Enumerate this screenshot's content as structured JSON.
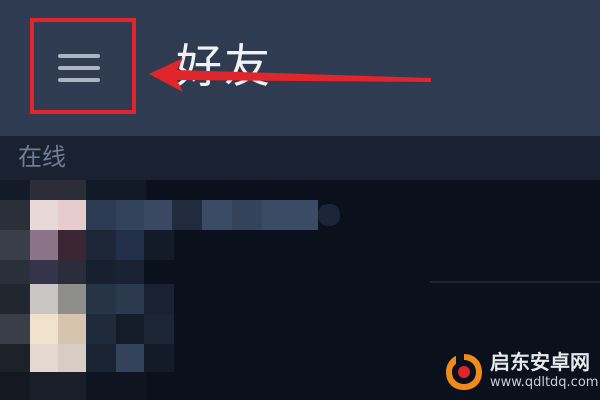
{
  "header": {
    "title": "好友",
    "menu_icon": "hamburger-menu-icon",
    "highlight_color": "#e0262b",
    "background_color": "#2f3b50"
  },
  "section": {
    "label": "在线"
  },
  "annotation": {
    "type": "red-arrow",
    "points_to": "menu-button",
    "color": "#e0262b"
  },
  "watermark": {
    "site_name": "启东安卓网",
    "url": "www.qdltdq.com"
  }
}
